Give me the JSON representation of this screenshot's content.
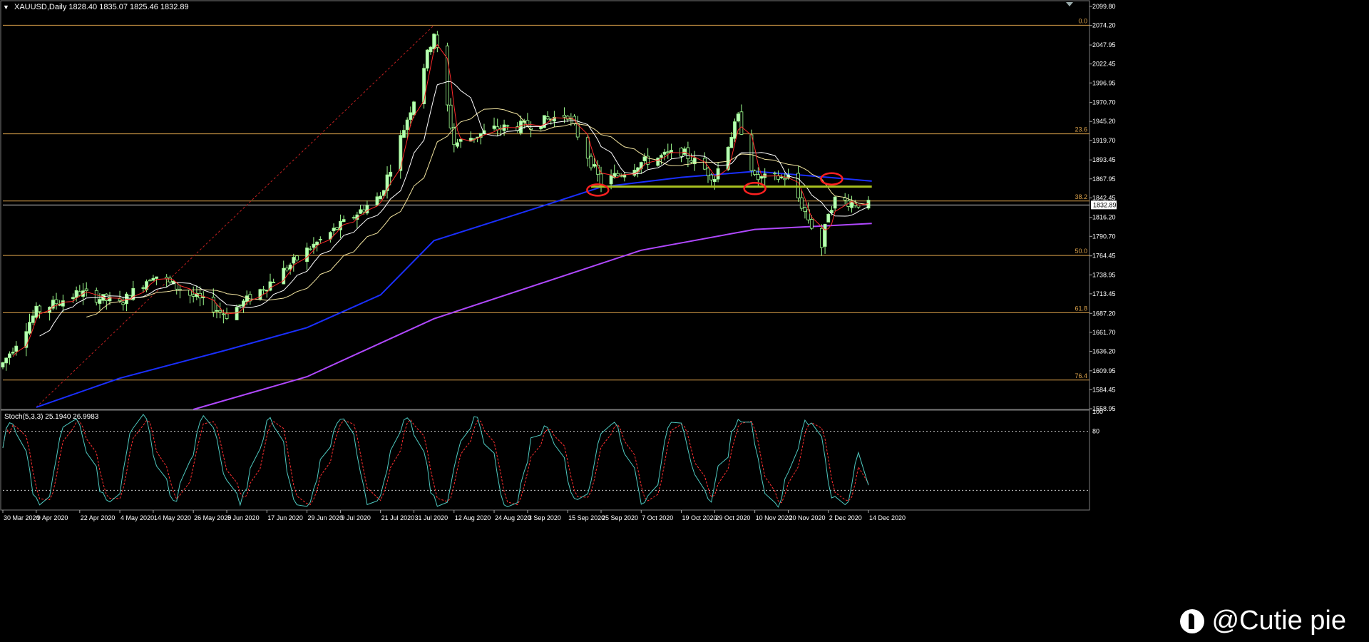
{
  "header": {
    "symbol": "XAUUSD,Daily",
    "ohlc": "1828.40 1835.07 1825.46 1832.89"
  },
  "stoch_header": "Stoch(5,3,3) 25.1940 26.9983",
  "watermark": "@Cutie pie",
  "colors": {
    "background": "#000000",
    "bull_candle": "#b8ffb8",
    "bear_candle": "#a0ff90",
    "fib": "#d9a04a",
    "ma_fast": "#ff2a2a",
    "ma_white": "#ffffff",
    "ma_yellow": "#f3e5a0",
    "ma_blue": "#1a2fff",
    "ma_purple": "#b048ff",
    "support": "#a8c020",
    "highlight": "#ff2020",
    "stoch_main": "#4ec9c0",
    "stoch_signal": "#ff3030"
  },
  "chart_data": {
    "type": "candlestick",
    "symbol": "XAUUSD",
    "timeframe": "Daily",
    "price_axis": {
      "range": [
        1558.95,
        2099.8
      ],
      "ticks": [
        2099.8,
        2074.2,
        2047.95,
        2022.45,
        1996.95,
        1970.7,
        1945.2,
        1919.7,
        1893.45,
        1867.95,
        1842.45,
        1816.2,
        1790.7,
        1764.45,
        1738.95,
        1713.45,
        1687.2,
        1661.7,
        1636.2,
        1609.95,
        1584.45,
        1558.95
      ],
      "current_price": 1832.89,
      "current_price_label": "1832.89"
    },
    "date_axis": {
      "labels": [
        "30 Mar 2020",
        "9 Apr 2020",
        "22 Apr 2020",
        "4 May 2020",
        "14 May 2020",
        "26 May 2020",
        "5 Jun 2020",
        "17 Jun 2020",
        "29 Jun 2020",
        "9 Jul 2020",
        "21 Jul 2020",
        "31 Jul 2020",
        "12 Aug 2020",
        "24 Aug 2020",
        "3 Sep 2020",
        "15 Sep 2020",
        "25 Sep 2020",
        "7 Oct 2020",
        "19 Oct 2020",
        "29 Oct 2020",
        "10 Nov 2020",
        "20 Nov 2020",
        "2 Dec 2020",
        "14 Dec 2020"
      ]
    },
    "fibonacci": [
      {
        "label": "0.0",
        "price": 2074.5
      },
      {
        "label": "23.6",
        "price": 1928.5
      },
      {
        "label": "38.2",
        "price": 1838.2
      },
      {
        "label": "50.0",
        "price": 1765.0
      },
      {
        "label": "61.8",
        "price": 1688.0
      },
      {
        "label": "76.4",
        "price": 1597.5
      }
    ],
    "support_line": {
      "price": 1857.5,
      "from": "22 Sep 2020",
      "to": "15 Dec 2020"
    },
    "trend_line": {
      "from": {
        "date": "9 Apr 2020",
        "price": 1561
      },
      "to": {
        "date": "6 Aug 2020",
        "price": 2074.5
      }
    },
    "highlights": [
      {
        "date": "24 Sep 2020",
        "price": 1853
      },
      {
        "date": "10 Nov 2020",
        "price": 1855
      },
      {
        "date": "3 Dec 2020",
        "price": 1868
      }
    ],
    "closes": [
      {
        "date": "30 Mar 2020",
        "price": 1620
      },
      {
        "date": "9 Apr 2020",
        "price": 1690
      },
      {
        "date": "22 Apr 2020",
        "price": 1715
      },
      {
        "date": "4 May 2020",
        "price": 1700
      },
      {
        "date": "14 May 2020",
        "price": 1740
      },
      {
        "date": "26 May 2020",
        "price": 1710
      },
      {
        "date": "5 Jun 2020",
        "price": 1685
      },
      {
        "date": "17 Jun 2020",
        "price": 1725
      },
      {
        "date": "29 Jun 2020",
        "price": 1772
      },
      {
        "date": "9 Jul 2020",
        "price": 1805
      },
      {
        "date": "21 Jul 2020",
        "price": 1845
      },
      {
        "date": "31 Jul 2020",
        "price": 1975
      },
      {
        "date": "6 Aug 2020",
        "price": 2065
      },
      {
        "date": "12 Aug 2020",
        "price": 1915
      },
      {
        "date": "24 Aug 2020",
        "price": 1935
      },
      {
        "date": "3 Sep 2020",
        "price": 1940
      },
      {
        "date": "15 Sep 2020",
        "price": 1955
      },
      {
        "date": "25 Sep 2020",
        "price": 1862
      },
      {
        "date": "7 Oct 2020",
        "price": 1890
      },
      {
        "date": "19 Oct 2020",
        "price": 1905
      },
      {
        "date": "29 Oct 2020",
        "price": 1870
      },
      {
        "date": "5 Nov 2020",
        "price": 1950
      },
      {
        "date": "10 Nov 2020",
        "price": 1868
      },
      {
        "date": "20 Nov 2020",
        "price": 1870
      },
      {
        "date": "30 Nov 2020",
        "price": 1777
      },
      {
        "date": "2 Dec 2020",
        "price": 1825
      },
      {
        "date": "4 Dec 2020",
        "price": 1840
      },
      {
        "date": "14 Dec 2020",
        "price": 1832.89
      }
    ],
    "ma_blue": [
      {
        "date": "9 Apr 2020",
        "price": 1561
      },
      {
        "date": "4 May 2020",
        "price": 1600
      },
      {
        "date": "5 Jun 2020",
        "price": 1638
      },
      {
        "date": "29 Jun 2020",
        "price": 1668
      },
      {
        "date": "21 Jul 2020",
        "price": 1712
      },
      {
        "date": "6 Aug 2020",
        "price": 1785
      },
      {
        "date": "3 Sep 2020",
        "price": 1825
      },
      {
        "date": "25 Sep 2020",
        "price": 1857
      },
      {
        "date": "19 Oct 2020",
        "price": 1870
      },
      {
        "date": "10 Nov 2020",
        "price": 1878
      },
      {
        "date": "2 Dec 2020",
        "price": 1870
      },
      {
        "date": "15 Dec 2020",
        "price": 1865
      }
    ],
    "ma_purple": [
      {
        "date": "26 May 2020",
        "price": 1558
      },
      {
        "date": "29 Jun 2020",
        "price": 1602
      },
      {
        "date": "6 Aug 2020",
        "price": 1680
      },
      {
        "date": "7 Oct 2020",
        "price": 1772
      },
      {
        "date": "10 Nov 2020",
        "price": 1800
      },
      {
        "date": "15 Dec 2020",
        "price": 1808
      }
    ],
    "stochastic": {
      "name": "Stoch(5,3,3)",
      "main": 25.194,
      "signal": 26.9983,
      "range": [
        0,
        100
      ],
      "levels": [
        80,
        20
      ],
      "ticks": [
        "100",
        "80"
      ]
    }
  }
}
